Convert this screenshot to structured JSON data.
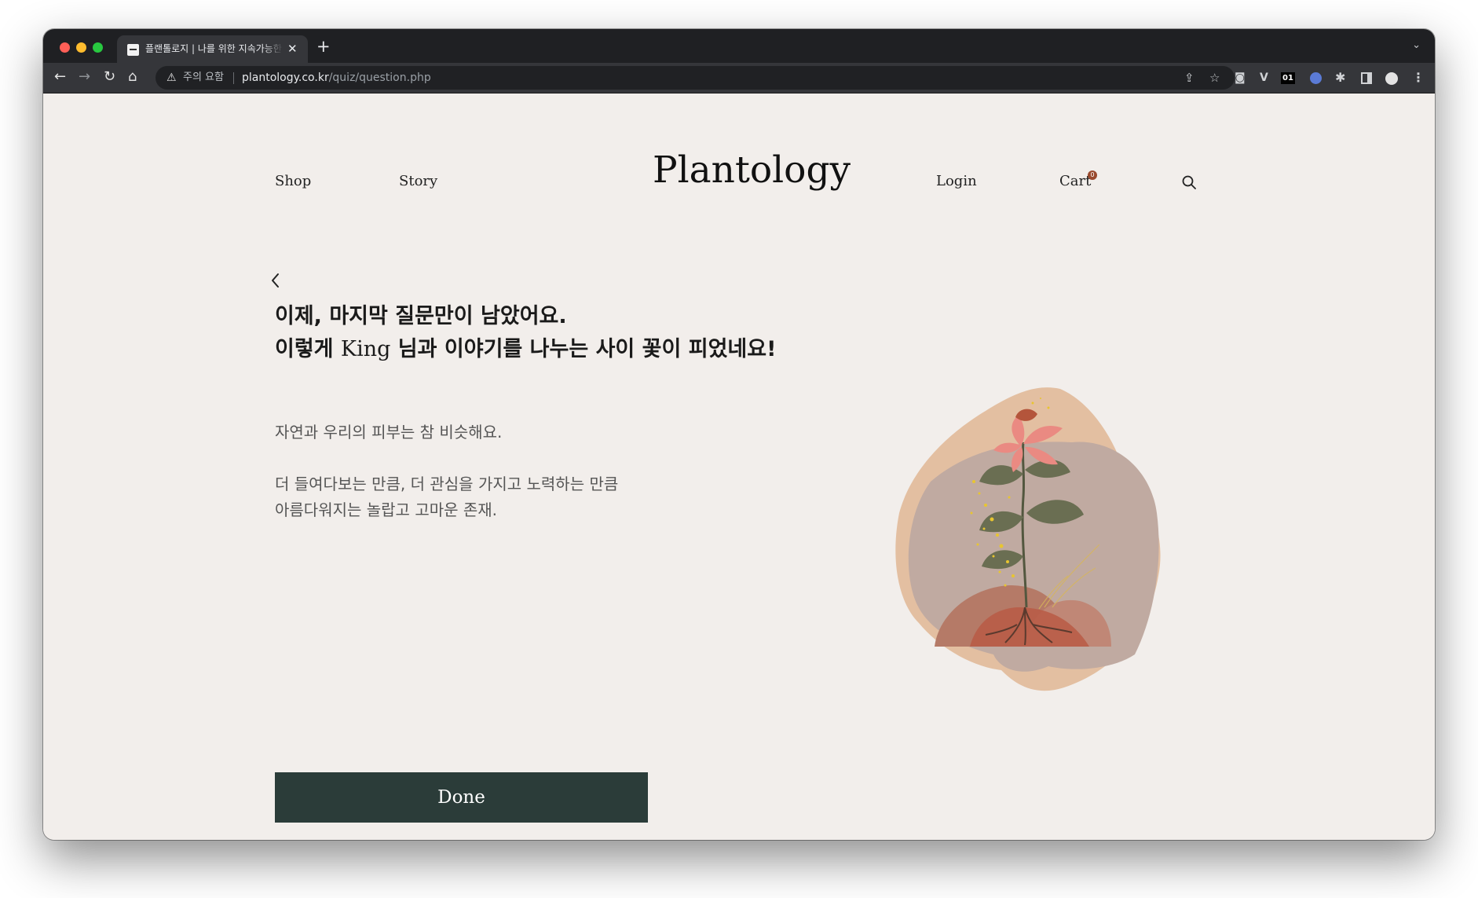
{
  "browser": {
    "tab_title": "플랜톨로지 | 나를 위한 지속가능한 케어",
    "tab_close": "✕",
    "new_tab": "+",
    "security_label": "주의 요함",
    "url_host": "plantology.co.kr",
    "url_path": "/quiz/question.php",
    "extension_badge": "01"
  },
  "site": {
    "logo": "Plantology",
    "nav": {
      "shop": "Shop",
      "story": "Story",
      "login": "Login",
      "cart": "Cart",
      "cart_count": "0"
    }
  },
  "quiz": {
    "heading_line1": "이제, 마지막 질문만이 남았어요.",
    "heading_line2_prefix": "이렇게 ",
    "user_name": "King",
    "heading_line2_suffix": " 님과 이야기를 나누는 사이 꽃이 피었네요!",
    "body_line1": "자연과 우리의 피부는 참 비슷해요.",
    "body_line2": "더 들여다보는 만큼, 더 관심을 가지고 노력하는 만큼",
    "body_line3": "아름다워지는 놀랍고 고마운 존재.",
    "done_label": "Done"
  },
  "colors": {
    "page_background": "#f2eeeb",
    "button_background": "#2b3c39",
    "cart_badge": "#9a4a2e"
  },
  "icons": [
    "back-arrow-icon",
    "forward-arrow-icon",
    "reload-icon",
    "home-icon",
    "warning-icon",
    "share-icon",
    "bookmark-star-icon",
    "camera-icon",
    "extension-v-icon",
    "extensions-puzzle-icon",
    "side-panel-icon",
    "profile-icon",
    "menu-kebab-icon",
    "search-icon",
    "chevron-left-icon"
  ]
}
